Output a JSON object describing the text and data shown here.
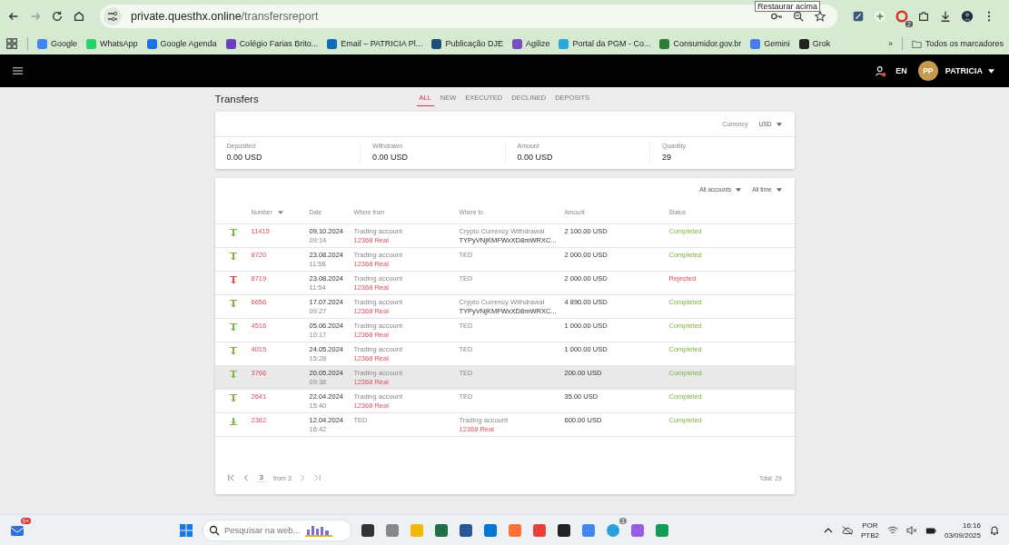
{
  "browser": {
    "url_host": "private.questhx.online",
    "url_path": "/transfersreport",
    "tooltip": "Restaurar acima",
    "extension_badge": "2",
    "bookmarks": [
      {
        "label": "Google",
        "color": "#4285f4"
      },
      {
        "label": "WhatsApp",
        "color": "#25d366"
      },
      {
        "label": "Google Agenda",
        "color": "#1a73e8"
      },
      {
        "label": "Colégio Farias Brito...",
        "color": "#6a3fc1"
      },
      {
        "label": "Email – PATRICIA Pl...",
        "color": "#0f6cbd"
      },
      {
        "label": "Publicação DJE",
        "color": "#1f4e79"
      },
      {
        "label": "Agilize",
        "color": "#7a4fbf"
      },
      {
        "label": "Portal da PGM - Co...",
        "color": "#29a8e0"
      },
      {
        "label": "Consumidor.gov.br",
        "color": "#2e7d32"
      },
      {
        "label": "Gemini",
        "color": "#4a7cf0"
      },
      {
        "label": "Grok",
        "color": "#222222"
      }
    ],
    "overflow": "»",
    "all_bookmarks": "Todos os marcadores"
  },
  "app_header": {
    "language": "EN",
    "avatar_initials": "PP",
    "user": "PATRICIA"
  },
  "page": {
    "title": "Transfers",
    "tabs": [
      {
        "label": "ALL",
        "selected": true
      },
      {
        "label": "NEW",
        "selected": false
      },
      {
        "label": "EXECUTED",
        "selected": false
      },
      {
        "label": "DECLINED",
        "selected": false
      },
      {
        "label": "DEPOSITS",
        "selected": false
      }
    ]
  },
  "summary": {
    "currency_label": "Currency",
    "currency": "USD",
    "stats": [
      {
        "label": "Deposited",
        "value": "0.00 USD"
      },
      {
        "label": "Withdrawn",
        "value": "0.00 USD"
      },
      {
        "label": "Amount",
        "value": "0.00 USD"
      },
      {
        "label": "Quantity",
        "value": "29"
      }
    ]
  },
  "table": {
    "filters": [
      "All accounts",
      "All time"
    ],
    "columns": [
      "Number",
      "Date",
      "Where from",
      "Where to",
      "Amount",
      "Status"
    ],
    "rows": [
      {
        "kind": "withdrawal",
        "number": "11415",
        "date": "09.10.2024",
        "time": "09:14",
        "from": "Trading account",
        "from_sub": "12368 Real",
        "to": "Crypto Currency Withdrawal",
        "to_sub": "TYPyVNjKMFWxXD8mWRXC...",
        "amount": "2 100.00 USD",
        "status": "Completed",
        "color": "#7cb342",
        "highlighted": false
      },
      {
        "kind": "withdrawal",
        "number": "8720",
        "date": "23.08.2024",
        "time": "11:56",
        "from": "Trading account",
        "from_sub": "12368 Real",
        "to": "TED",
        "amount": "2 000.00 USD",
        "status": "Completed",
        "color": "#7cb342",
        "highlighted": false
      },
      {
        "kind": "withdrawal",
        "number": "8719",
        "date": "23.08.2024",
        "time": "11:54",
        "from": "Trading account",
        "from_sub": "12368 Real",
        "to": "TED",
        "amount": "2 000.00 USD",
        "status": "Rejected",
        "color": "#e0505a",
        "highlighted": false
      },
      {
        "kind": "withdrawal",
        "number": "6656",
        "date": "17.07.2024",
        "time": "09:27",
        "from": "Trading account",
        "from_sub": "12368 Real",
        "to": "Crypto Currency Withdrawal",
        "to_sub": "TYPyVNjKMFWxXD8mWRXC...",
        "amount": "4 890.00 USD",
        "status": "Completed",
        "color": "#7cb342",
        "highlighted": false
      },
      {
        "kind": "withdrawal",
        "number": "4516",
        "date": "05.06.2024",
        "time": "10:17",
        "from": "Trading account",
        "from_sub": "12368 Real",
        "to": "TED",
        "amount": "1 000.00 USD",
        "status": "Completed",
        "color": "#7cb342",
        "highlighted": false
      },
      {
        "kind": "withdrawal",
        "number": "4015",
        "date": "24.05.2024",
        "time": "15:28",
        "from": "Trading account",
        "from_sub": "12368 Real",
        "to": "TED",
        "amount": "1 000.00 USD",
        "status": "Completed",
        "color": "#7cb342",
        "highlighted": false
      },
      {
        "kind": "withdrawal",
        "number": "3766",
        "date": "20.05.2024",
        "time": "09:38",
        "from": "Trading account",
        "from_sub": "12368 Real",
        "to": "TED",
        "amount": "200.00 USD",
        "status": "Completed",
        "color": "#7cb342",
        "highlighted": true
      },
      {
        "kind": "withdrawal",
        "number": "2641",
        "date": "22.04.2024",
        "time": "15:40",
        "from": "Trading account",
        "from_sub": "12368 Real",
        "to": "TED",
        "amount": "35.00 USD",
        "status": "Completed",
        "color": "#7cb342",
        "highlighted": false
      },
      {
        "kind": "deposit",
        "number": "2362",
        "date": "12.04.2024",
        "time": "16:42",
        "from": "TED",
        "to": "Trading account",
        "to_sub": "12368 Real",
        "amount": "600.00 USD",
        "status": "Completed",
        "color": "#7cb342",
        "highlighted": false
      }
    ],
    "pagination": {
      "page": "3",
      "of": "from 3"
    },
    "total": "Total: 29"
  },
  "taskbar": {
    "notification_badge": "9+",
    "search_placeholder": "Pesquisar na web...",
    "telegram_badge": "1",
    "language": "POR",
    "layout": "PTB2",
    "time": "16:16",
    "date": "03/09/2025"
  }
}
